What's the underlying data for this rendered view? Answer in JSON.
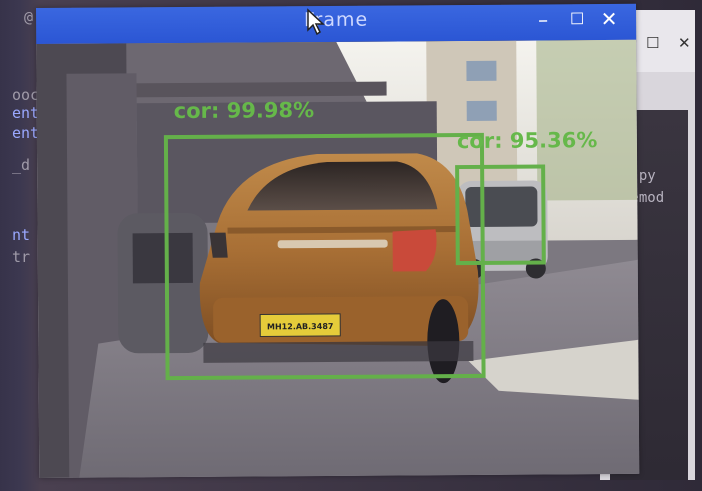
{
  "window": {
    "title": "Frame",
    "minimize_icon": "minimize-icon",
    "maximize_icon": "maximize-icon",
    "close_icon": "close-icon",
    "titlebar_color": "#2f5ad8"
  },
  "detections": [
    {
      "label": "cor: 99.98%",
      "color": "#64b04a"
    },
    {
      "label": "cor: 95.36%",
      "color": "#64b04a"
    }
  ],
  "scene": {
    "license_plate": "MH12.AB.3487"
  },
  "background_terminal": {
    "lines": [
      "@",
      "ooc",
      "ent",
      "ent",
      "_d",
      "nt",
      "tr"
    ]
  },
  "background_window": {
    "lines": [
      "p.py",
      "Femod"
    ]
  }
}
